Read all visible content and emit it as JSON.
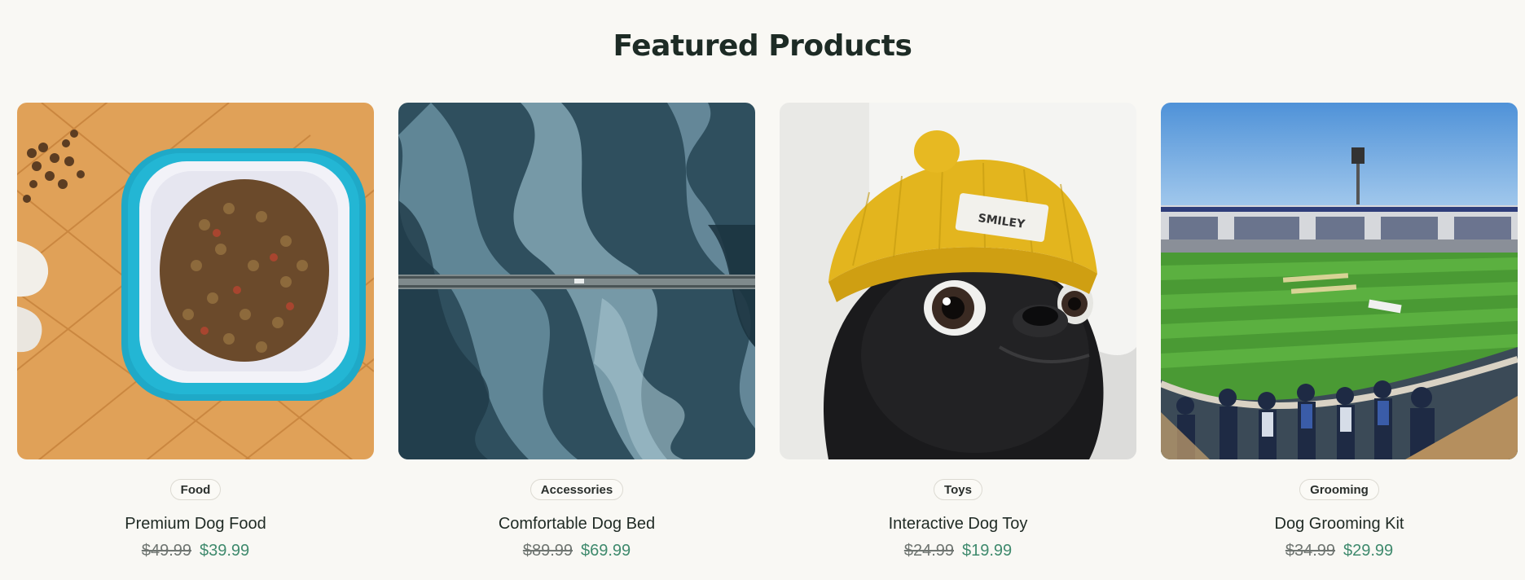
{
  "section": {
    "title": "Featured Products"
  },
  "products": [
    {
      "category": "Food",
      "name": "Premium Dog Food",
      "original_price": "$49.99",
      "sale_price": "$39.99",
      "image": "dog-food-bowl"
    },
    {
      "category": "Accessories",
      "name": "Comfortable Dog Bed",
      "original_price": "$89.99",
      "sale_price": "$69.99",
      "image": "aerial-river"
    },
    {
      "category": "Toys",
      "name": "Interactive Dog Toy",
      "original_price": "$24.99",
      "sale_price": "$19.99",
      "image": "pug-yellow-beanie",
      "image_text": "SMILEY"
    },
    {
      "category": "Grooming",
      "name": "Dog Grooming Kit",
      "original_price": "$34.99",
      "sale_price": "$29.99",
      "image": "cricket-stadium"
    }
  ],
  "colors": {
    "background": "#f9f8f4",
    "heading": "#1d2b25",
    "sale_price": "#3f8a6d",
    "original_price": "#6f7571"
  }
}
